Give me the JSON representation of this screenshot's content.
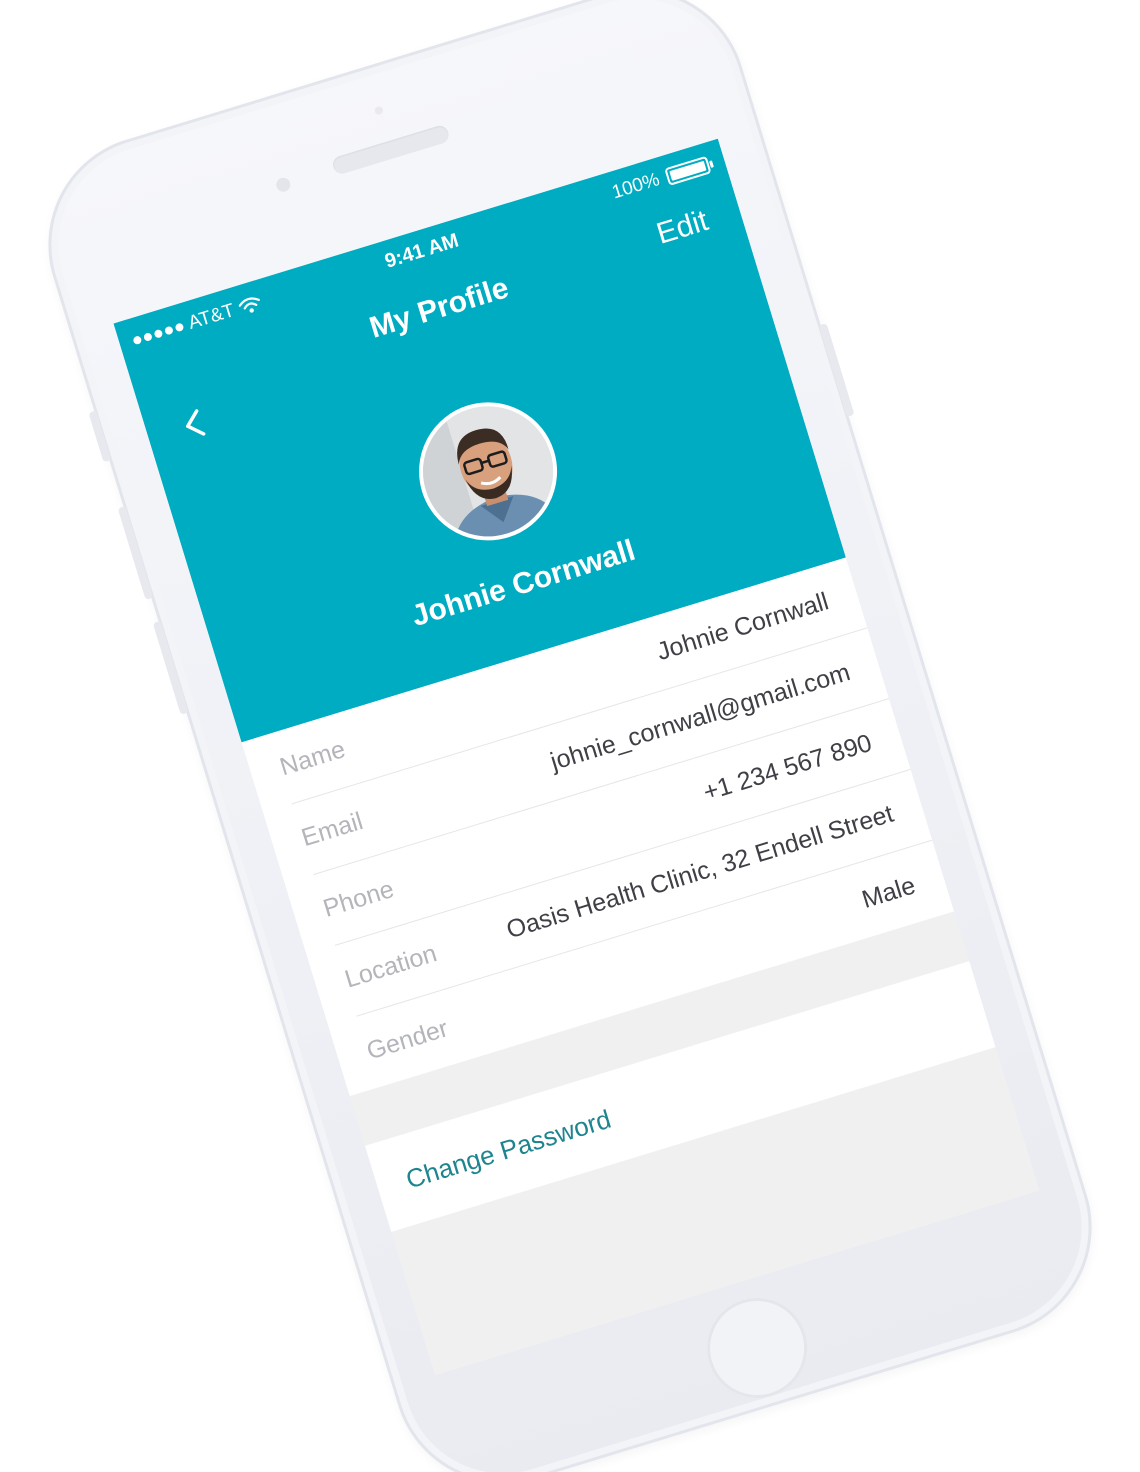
{
  "status_bar": {
    "carrier": "AT&T",
    "time": "9:41 AM",
    "battery_text": "100%",
    "battery_level": 1.0
  },
  "nav": {
    "title": "My Profile",
    "edit_label": "Edit",
    "back_icon": "chevron-left-icon"
  },
  "profile": {
    "name": "Johnie Cornwall"
  },
  "fields": [
    {
      "label": "Name",
      "value": "Johnie Cornwall"
    },
    {
      "label": "Email",
      "value": "johnie_cornwall@gmail.com"
    },
    {
      "label": "Phone",
      "value": "+1 234 567 890"
    },
    {
      "label": "Location",
      "value": "Oasis Health Clinic, 32 Endell Street"
    },
    {
      "label": "Gender",
      "value": "Male"
    }
  ],
  "actions": {
    "change_password": "Change Password"
  },
  "colors": {
    "header": "#00acc1",
    "link": "#1e858f",
    "screen_bg": "#f0f0f1"
  }
}
